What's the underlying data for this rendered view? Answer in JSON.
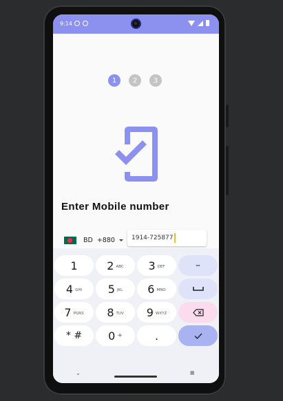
{
  "status_bar": {
    "time": "9:14"
  },
  "stepper": [
    {
      "label": "1",
      "color": "#8c91f0",
      "active": true
    },
    {
      "label": "2",
      "color": "#c4c4c4",
      "active": false
    },
    {
      "label": "3",
      "color": "#c4c4c4",
      "active": false
    }
  ],
  "colors": {
    "accent": "#8c91f0",
    "icon": "#8c91f0"
  },
  "page": {
    "title": "Enter Mobile number"
  },
  "country": {
    "code_name": "BD",
    "dial_code": "+880"
  },
  "phone_input": {
    "value": "1914-725877"
  },
  "keypad": {
    "k1": {
      "num": "1",
      "sub": ""
    },
    "k2": {
      "num": "2",
      "sub": "ABC"
    },
    "k3": {
      "num": "3",
      "sub": "DEF"
    },
    "k4": {
      "num": "4",
      "sub": "GHI"
    },
    "k5": {
      "num": "5",
      "sub": "JKL"
    },
    "k6": {
      "num": "6",
      "sub": "MNO"
    },
    "k7": {
      "num": "7",
      "sub": "PQRS"
    },
    "k8": {
      "num": "8",
      "sub": "TUV"
    },
    "k9": {
      "num": "9",
      "sub": "WXYZ"
    },
    "kstar": {
      "num": "* #",
      "sub": ""
    },
    "k0": {
      "num": "0",
      "sub": "+"
    },
    "kdot": {
      "num": ".",
      "sub": ""
    },
    "kdash": {
      "num": "–"
    }
  }
}
